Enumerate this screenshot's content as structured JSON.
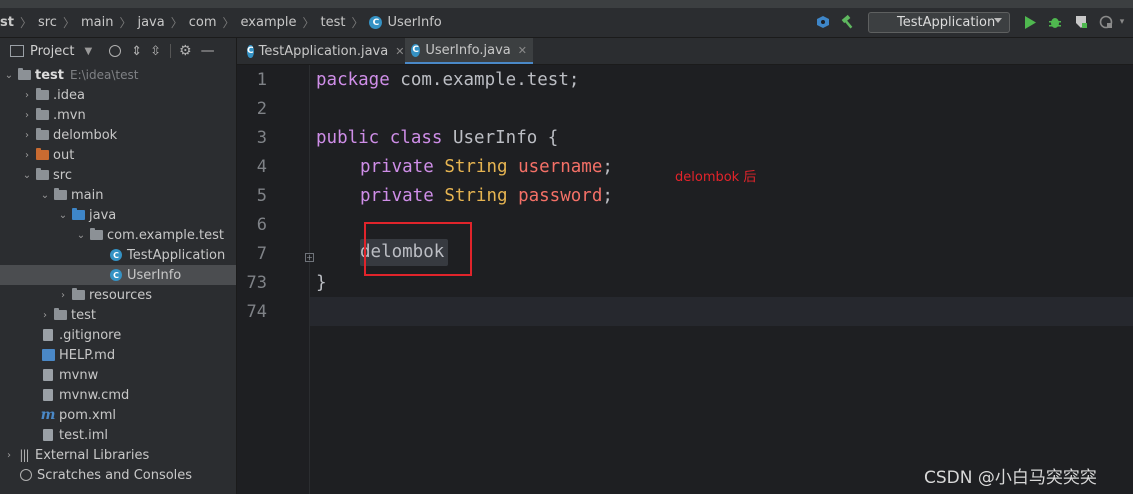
{
  "breadcrumb": [
    "st",
    "src",
    "main",
    "java",
    "com",
    "example",
    "test",
    "UserInfo"
  ],
  "toolbar": {
    "run_config": "TestApplication"
  },
  "sidebar": {
    "header_label": "Project",
    "root": {
      "name": "test",
      "path": "E:\\idea\\test"
    },
    "items": [
      {
        "label": ".idea"
      },
      {
        "label": ".mvn"
      },
      {
        "label": "delombok"
      },
      {
        "label": "out"
      },
      {
        "label": "src"
      },
      {
        "label": "main"
      },
      {
        "label": "java"
      },
      {
        "label": "com.example.test"
      },
      {
        "label": "TestApplication"
      },
      {
        "label": "UserInfo"
      },
      {
        "label": "resources"
      },
      {
        "label": "test"
      },
      {
        "label": ".gitignore"
      },
      {
        "label": "HELP.md"
      },
      {
        "label": "mvnw"
      },
      {
        "label": "mvnw.cmd"
      },
      {
        "label": "pom.xml"
      },
      {
        "label": "test.iml"
      },
      {
        "label": "External Libraries"
      },
      {
        "label": "Scratches and Consoles"
      }
    ]
  },
  "tabs": [
    {
      "label": "TestApplication.java"
    },
    {
      "label": "UserInfo.java"
    }
  ],
  "editor": {
    "line_numbers": [
      "1",
      "2",
      "3",
      "4",
      "5",
      "6",
      "7",
      "73",
      "74"
    ],
    "code": {
      "l1_kw": "package",
      "l1_rest": " com.example.test;",
      "l3_kw1": "public",
      "l3_kw2": "class",
      "l3_rest": " UserInfo {",
      "l4_kw": "private",
      "l4_ty": "String",
      "l4_fd": "username",
      "l4_end": ";",
      "l5_kw": "private",
      "l5_ty": "String",
      "l5_fd": "password",
      "l5_end": ";",
      "l7_folded": "delombok",
      "l73": "}"
    },
    "annotation": "delombok 后"
  },
  "watermark": "CSDN @小白马突突突",
  "colors": {
    "keyword": "#cf8ee8",
    "type": "#e6b451",
    "field": "#f47067",
    "annotation_red": "#e3242b"
  }
}
